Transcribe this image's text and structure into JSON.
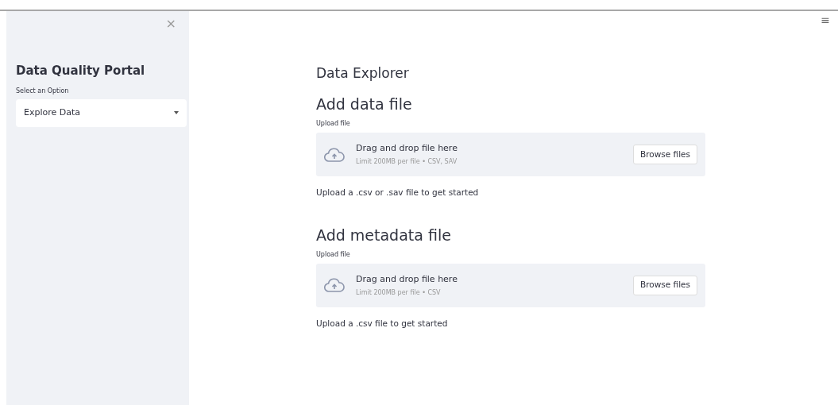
{
  "sidebar": {
    "close": "×",
    "title": "Data Quality Portal",
    "select": {
      "label": "Select an Option",
      "value": "Explore Data"
    }
  },
  "menu": "≡",
  "main": {
    "title": "Data Explorer",
    "sections": [
      {
        "heading": "Add data file",
        "label": "Upload file",
        "drop": "Drag and drop file here",
        "limit": "Limit 200MB per file • CSV, SAV",
        "button": "Browse files",
        "info": "Upload a .csv or .sav file to get started"
      },
      {
        "heading": "Add metadata file",
        "label": "Upload file",
        "drop": "Drag and drop file here",
        "limit": "Limit 200MB per file • CSV",
        "button": "Browse files",
        "info": "Upload a .csv file to get started"
      }
    ]
  }
}
